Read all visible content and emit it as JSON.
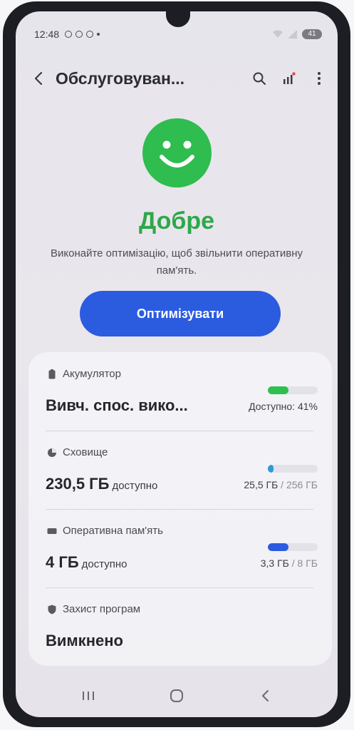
{
  "status_bar": {
    "time": "12:48",
    "battery": "41"
  },
  "header": {
    "title": "Обслуговуван..."
  },
  "status": {
    "label": "Добре",
    "description": "Виконайте оптимізацію, щоб звільнити оперативну пам'ять.",
    "color": "#2ebd4e"
  },
  "optimize_label": "Оптимізувати",
  "rows": {
    "battery": {
      "label": "Акумулятор",
      "value": "Вивч. спос. вико...",
      "usage": "Доступно: 41%",
      "level": 0.41,
      "color": "#2fbf4f"
    },
    "storage": {
      "label": "Сховище",
      "value": "230,5 ГБ",
      "suffix": "доступно",
      "used": "25,5 ГБ",
      "sep": " / ",
      "total": "256 ГБ",
      "level": 0.1,
      "color": "#2b9ad6"
    },
    "ram": {
      "label": "Оперативна пам'ять",
      "value": "4 ГБ",
      "suffix": "доступно",
      "used": "3,3 ГБ",
      "sep": " / ",
      "total": "8 ГБ",
      "level": 0.41,
      "color": "#2b5ce0"
    },
    "protection": {
      "label": "Захист програм",
      "value": "Вимкнено"
    }
  },
  "icons": {
    "back": "back-arrow-icon",
    "search": "search-icon",
    "stats": "stats-icon",
    "more": "more-vert-icon",
    "nav_recents": "recents-icon",
    "nav_home": "home-icon",
    "nav_back": "back-icon"
  },
  "accent": "#2b5ce0"
}
